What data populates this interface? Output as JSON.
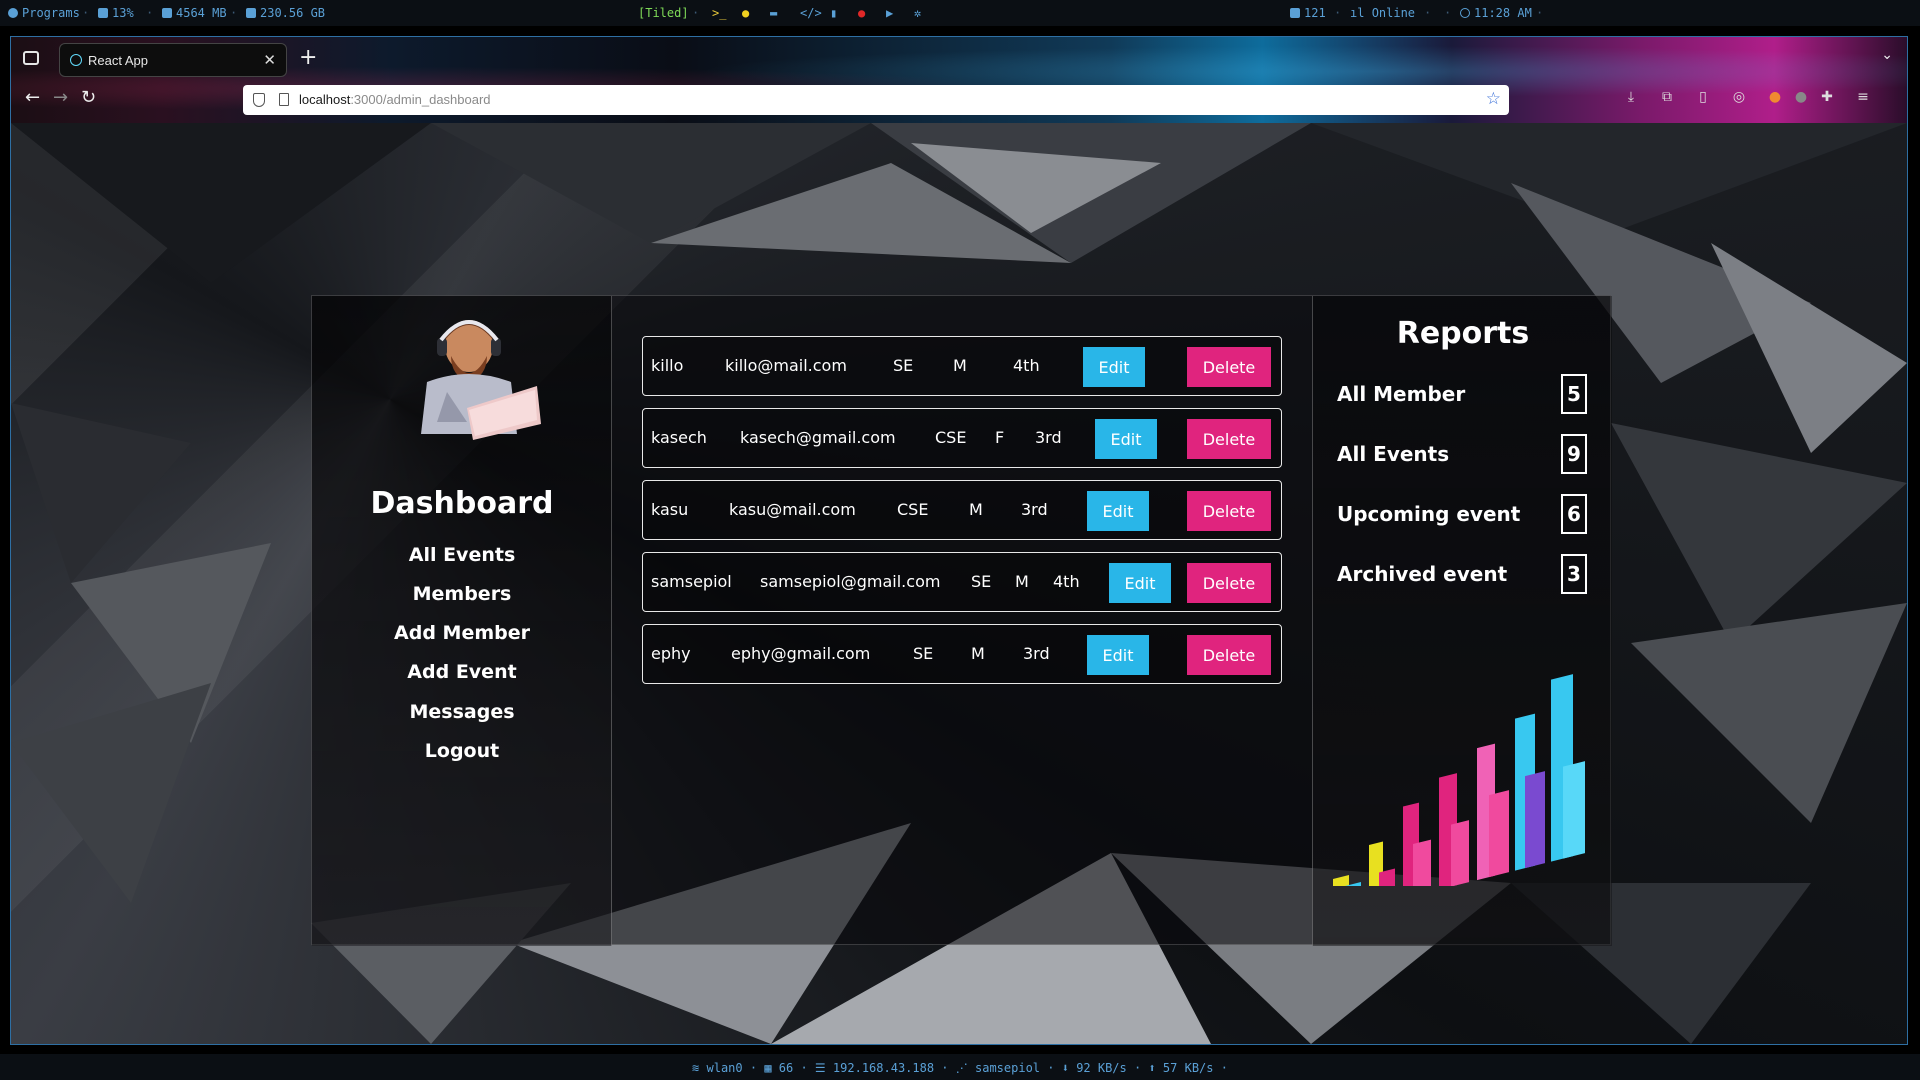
{
  "topbar": {
    "programs": "Programs",
    "cpu": "13%",
    "mem": "4564 MB",
    "disk": "230.56 GB",
    "tiled": "[Tiled]",
    "updates": "121",
    "network": "Online",
    "time": "11:28 AM"
  },
  "browser": {
    "tab_title": "React App",
    "url_host": "localhost",
    "url_path": ":3000/admin_dashboard"
  },
  "sidebar": {
    "title": "Dashboard",
    "items": [
      "All Events",
      "Members",
      "Add Member",
      "Add Event",
      "Messages",
      "Logout"
    ]
  },
  "members": [
    {
      "name": "killo",
      "email": "killo@mail.com",
      "dept": "SE",
      "gender": "M",
      "year": "4th",
      "edit": "Edit",
      "delete": "Delete"
    },
    {
      "name": "kasech",
      "email": "kasech@gmail.com",
      "dept": "CSE",
      "gender": "F",
      "year": "3rd",
      "edit": "Edit",
      "delete": "Delete"
    },
    {
      "name": "kasu",
      "email": "kasu@mail.com",
      "dept": "CSE",
      "gender": "M",
      "year": "3rd",
      "edit": "Edit",
      "delete": "Delete"
    },
    {
      "name": "samsepiol",
      "email": "samsepiol@gmail.com",
      "dept": "SE",
      "gender": "M",
      "year": "4th",
      "edit": "Edit",
      "delete": "Delete"
    },
    {
      "name": "ephy",
      "email": "ephy@gmail.com",
      "dept": "SE",
      "gender": "M",
      "year": "3rd",
      "edit": "Edit",
      "delete": "Delete"
    }
  ],
  "reports": {
    "title": "Reports",
    "items": [
      {
        "label": "All Member",
        "value": "5"
      },
      {
        "label": "All Events",
        "value": "9"
      },
      {
        "label": "Upcoming event",
        "value": "6"
      },
      {
        "label": "Archived event",
        "value": "3"
      }
    ]
  },
  "statusbar": {
    "iface": "wlan0",
    "signal": "66",
    "ip": "192.168.43.188",
    "host": "samsepiol",
    "down": "92 KB/s",
    "up": "57 KB/s"
  },
  "colors": {
    "edit": "#29b6e8",
    "delete": "#e0247e",
    "accent": "#5aa0d6"
  }
}
